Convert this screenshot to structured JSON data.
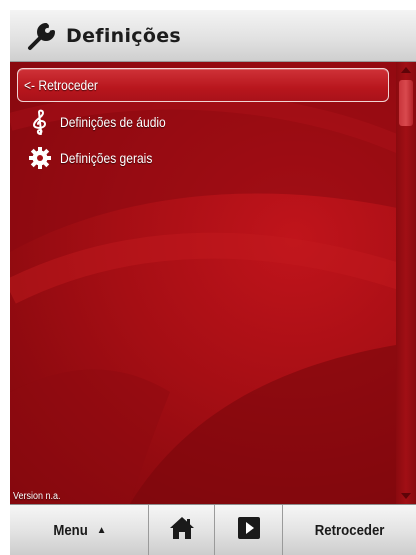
{
  "header": {
    "title": "Definições",
    "icon": "wrench-icon"
  },
  "menu": {
    "items": [
      {
        "label": "<- Retroceder",
        "icon": "",
        "selected": true
      },
      {
        "label": "Definições de áudio",
        "icon": "treble-clef-icon",
        "selected": false
      },
      {
        "label": "Definições gerais",
        "icon": "gear-icon",
        "selected": false
      }
    ]
  },
  "version_text": "Version n.a.",
  "toolbar": {
    "menu_label": "Menu",
    "menu_caret": "▲",
    "home_icon": "home-icon",
    "play_icon": "play-icon",
    "back_label": "Retroceder"
  },
  "colors": {
    "background_red": "#a50e14",
    "selection_border": "#f1d4d4",
    "toolbar_gray": "#e4e4e4"
  }
}
